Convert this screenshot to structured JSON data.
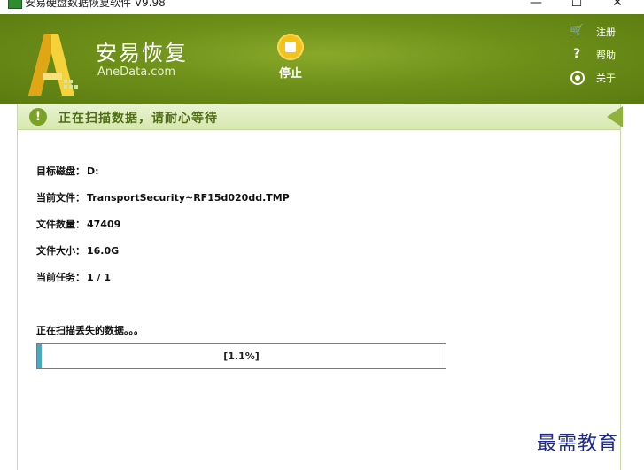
{
  "window": {
    "title": "安易硬盘数据恢复软件 V9.98",
    "minimize": "—",
    "maximize": "☐",
    "close": "✕"
  },
  "header": {
    "brand_cn": "安易恢复",
    "brand_en": "AneData.com",
    "stop_label": "停止",
    "links": [
      {
        "icon": "cart-icon",
        "label": "注册"
      },
      {
        "icon": "help-icon",
        "label": "帮助"
      },
      {
        "icon": "about-icon",
        "label": "关于"
      }
    ]
  },
  "status": {
    "icon": "alert-icon",
    "text": "正在扫描数据，请耐心等待"
  },
  "info": [
    {
      "key": "目标磁盘：",
      "value": "D:"
    },
    {
      "key": "当前文件：",
      "value": "TransportSecurity~RF15d020dd.TMP"
    },
    {
      "key": "文件数量：",
      "value": "47409"
    },
    {
      "key": "文件大小：",
      "value": "16.0G"
    },
    {
      "key": "当前任务：",
      "value": "1 / 1"
    }
  ],
  "progress": {
    "label": "正在扫描丢失的数据。。。",
    "percent_text": "[1.1%]",
    "value": 1.1
  },
  "watermark": "最需教育",
  "colors": {
    "header_green": "#6e9019",
    "accent_yellow": "#f3c319",
    "progress_fill": "#4aa8c0"
  }
}
